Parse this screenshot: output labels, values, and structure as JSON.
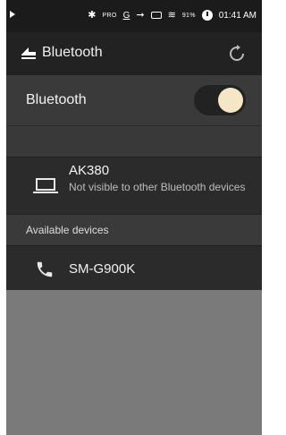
{
  "status_bar": {
    "pro_label": "PRO",
    "g_label": "G",
    "battery_percent": "91%",
    "time": "01:41 AM"
  },
  "app_bar": {
    "title": "Bluetooth"
  },
  "toggle_row": {
    "label": "Bluetooth",
    "enabled": true
  },
  "paired_device": {
    "name": "AK380",
    "status": "Not visible to other Bluetooth devices",
    "icon": "laptop-icon"
  },
  "available_section": {
    "header": "Available devices",
    "devices": [
      {
        "name": "SM-G900K",
        "icon": "phone-icon"
      }
    ]
  },
  "colors": {
    "switch_knob": "#f5e6c8",
    "background": "#2c2c2c"
  }
}
